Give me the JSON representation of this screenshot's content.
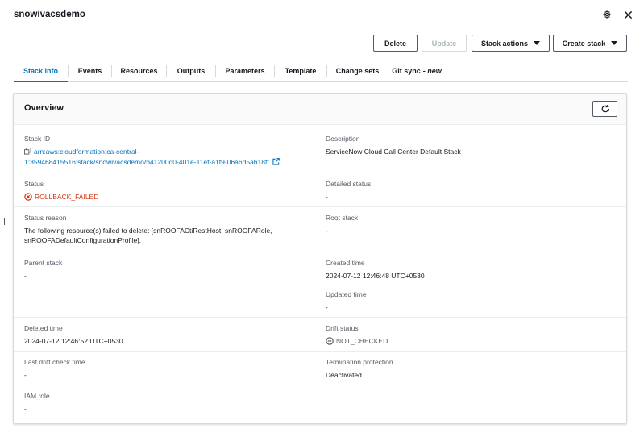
{
  "header": {
    "title": "snowivacsdemo",
    "settings_icon": "gear-icon",
    "close_icon": "close-icon"
  },
  "actions": {
    "delete": "Delete",
    "update": "Update",
    "stack_actions": "Stack actions",
    "create_stack": "Create stack"
  },
  "tabs": [
    {
      "label": "Stack info",
      "active": true
    },
    {
      "label": "Events"
    },
    {
      "label": "Resources"
    },
    {
      "label": "Outputs"
    },
    {
      "label": "Parameters"
    },
    {
      "label": "Template"
    },
    {
      "label": "Change sets"
    },
    {
      "label": "Git sync",
      "suffix": "- new"
    }
  ],
  "overview": {
    "title": "Overview",
    "stack_id": {
      "label": "Stack ID",
      "line1": "arn:aws:cloudformation:ca-central-",
      "line2": "1:359468415516:stack/snowivacsdemo/b41200d0-401e-11ef-a1f9-06a6d5ab18ff"
    },
    "description": {
      "label": "Description",
      "value": "ServiceNow Cloud Call Center Default Stack"
    },
    "status": {
      "label": "Status",
      "value": "ROLLBACK_FAILED"
    },
    "detailed_status": {
      "label": "Detailed status",
      "value": "-"
    },
    "status_reason": {
      "label": "Status reason",
      "line1": "The following resource(s) failed to delete: [snROOFACtiRestHost, snROOFARole,",
      "line2": "snROOFADefaultConfigurationProfile]."
    },
    "root_stack": {
      "label": "Root stack",
      "value": "-"
    },
    "parent_stack": {
      "label": "Parent stack",
      "value": "-"
    },
    "created_time": {
      "label": "Created time",
      "value": "2024-07-12 12:46:48 UTC+0530"
    },
    "updated_time": {
      "label": "Updated time",
      "value": "-"
    },
    "deleted_time": {
      "label": "Deleted time",
      "value": "2024-07-12 12:46:52 UTC+0530"
    },
    "drift_status": {
      "label": "Drift status",
      "value": "NOT_CHECKED"
    },
    "last_drift_check": {
      "label": "Last drift check time",
      "value": "-"
    },
    "termination_protection": {
      "label": "Termination protection",
      "value": "Deactivated"
    },
    "iam_role": {
      "label": "IAM role",
      "value": "-"
    }
  },
  "colors": {
    "link": "#0073bb",
    "error": "#d13212",
    "text": "#16191f",
    "muted": "#545b64"
  }
}
